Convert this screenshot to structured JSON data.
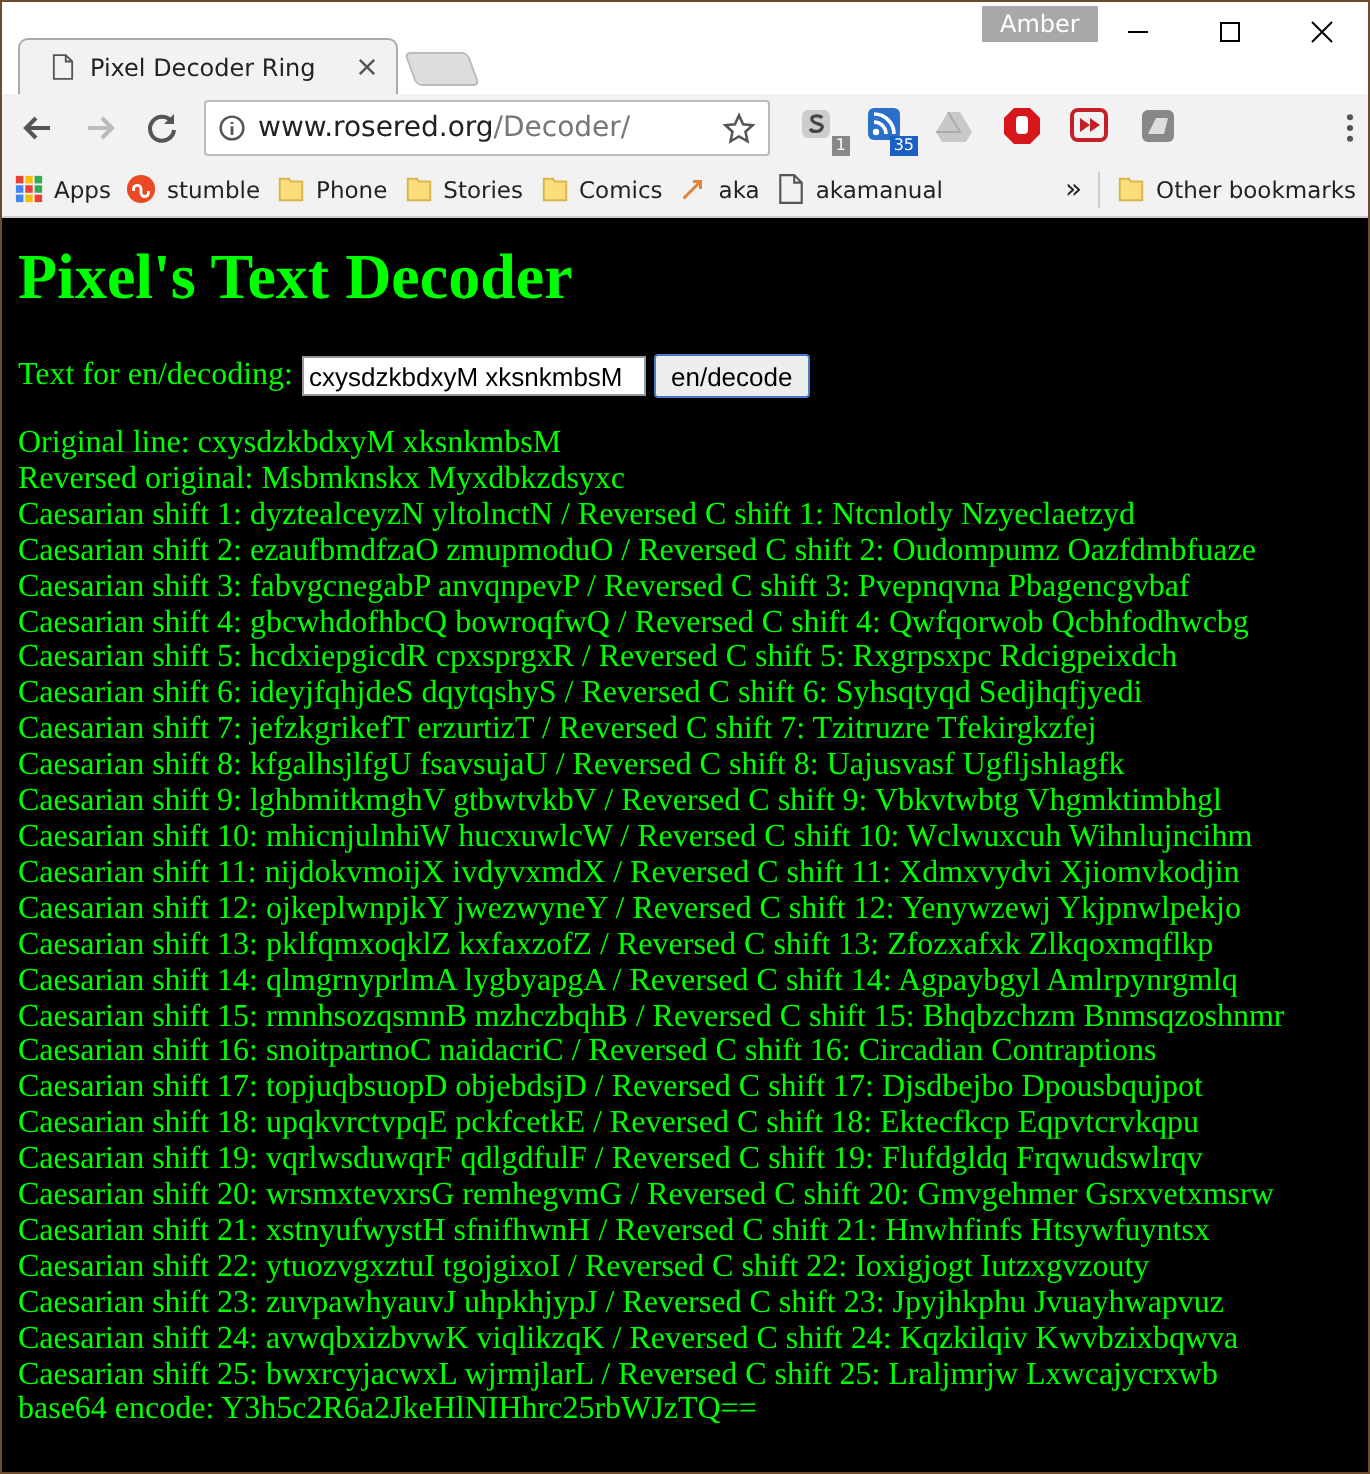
{
  "profile": "Amber",
  "tabs": [
    {
      "title": "Pixel Decoder Ring",
      "selected": true
    }
  ],
  "address": {
    "host": "www.rosered.org",
    "path": "/Decoder/"
  },
  "extensions": [
    {
      "kind": "s",
      "badge": "1"
    },
    {
      "kind": "feed",
      "badge": "35"
    },
    {
      "kind": "drive"
    },
    {
      "kind": "stop"
    },
    {
      "kind": "play"
    },
    {
      "kind": "box"
    }
  ],
  "bookmarks": [
    {
      "kind": "apps",
      "label": "Apps"
    },
    {
      "kind": "stumble",
      "label": "stumble"
    },
    {
      "kind": "folder",
      "label": "Phone"
    },
    {
      "kind": "folder",
      "label": "Stories"
    },
    {
      "kind": "folder",
      "label": "Comics"
    },
    {
      "kind": "link",
      "label": "aka"
    },
    {
      "kind": "page",
      "label": "akamanual"
    }
  ],
  "bookmarks_overflow": "»",
  "other_bookmarks": "Other bookmarks",
  "page": {
    "heading": "Pixel's Text Decoder",
    "form": {
      "label": "Text for en/decoding:",
      "value": "cxysdzkbdxyM xksnkmbsM",
      "button": "en/decode"
    },
    "output_lines": [
      "Original line: cxysdzkbdxyM xksnkmbsM",
      "Reversed original: Msbmknskx Myxdbkzdsyxc",
      "Caesarian shift 1: dyztealceyzN yltolnctN / Reversed C shift 1: Ntcnlotly Nzyeclaetzyd",
      "Caesarian shift 2: ezaufbmdfzaO zmupmoduO / Reversed C shift 2: Oudompumz Oazfdmbfuaze",
      "Caesarian shift 3: fabvgcnegabP anvqnpevP / Reversed C shift 3: Pvepnqvna Pbagencgvbaf",
      "Caesarian shift 4: gbcwhdofhbcQ bowroqfwQ / Reversed C shift 4: Qwfqorwob Qcbhfodhwcbg",
      "Caesarian shift 5: hcdxiepgicdR cpxsprgxR / Reversed C shift 5: Rxgrpsxpc Rdcigpeixdch",
      "Caesarian shift 6: ideyjfqhjdeS dqytqshyS / Reversed C shift 6: Syhsqtyqd Sedjhqfjyedi",
      "Caesarian shift 7: jefzkgrikefT erzurtizT / Reversed C shift 7: Tzitruzre Tfekirgkzfej",
      "Caesarian shift 8: kfgalhsjlfgU fsavsujaU / Reversed C shift 8: Uajusvasf Ugfljshlagfk",
      "Caesarian shift 9: lghbmitkmghV gtbwtvkbV / Reversed C shift 9: Vbkvtwbtg Vhgmktimbhgl",
      "Caesarian shift 10: mhicnjulnhiW hucxuwlcW / Reversed C shift 10: Wclwuxcuh Wihnlujncihm",
      "Caesarian shift 11: nijdokvmoijX ivdyvxmdX / Reversed C shift 11: Xdmxvydvi Xjiomvkodjin",
      "Caesarian shift 12: ojkeplwnpjkY jwezwyneY / Reversed C shift 12: Yenywzewj Ykjpnwlpekjo",
      "Caesarian shift 13: pklfqmxoqklZ kxfaxzofZ / Reversed C shift 13: Zfozxafxk Zlkqoxmqflkp",
      "Caesarian shift 14: qlmgrnyprlmA lygbyapgA / Reversed C shift 14: Agpaybgyl Amlrpynrgmlq",
      "Caesarian shift 15: rmnhsozqsmnB mzhczbqhB / Reversed C shift 15: Bhqbzchzm Bnmsqzoshnmr",
      "Caesarian shift 16: snoitpartnoC naidacriC / Reversed C shift 16: Circadian Contraptions",
      "Caesarian shift 17: topjuqbsuopD objebdsjD / Reversed C shift 17: Djsdbejbo Dpousbqujpot",
      "Caesarian shift 18: upqkvrctvpqE pckfcetkE / Reversed C shift 18: Ektecfkcp Eqpvtcrvkqpu",
      "Caesarian shift 19: vqrlwsduwqrF qdlgdfulF / Reversed C shift 19: Flufdgldq Frqwudswlrqv",
      "Caesarian shift 20: wrsmxtevxrsG remhegvmG / Reversed C shift 20: Gmvgehmer Gsrxvetxmsrw",
      "Caesarian shift 21: xstnyufwystH sfnifhwnH / Reversed C shift 21: Hnwhfinfs Htsywfuyntsx",
      "Caesarian shift 22: ytuozvgxztuI tgojgixoI / Reversed C shift 22: Ioxigjogt Iutzxgvzouty",
      "Caesarian shift 23: zuvpawhyauvJ uhpkhjypJ / Reversed C shift 23: Jpyjhkphu Jvuayhwapvuz",
      "Caesarian shift 24: avwqbxizbvwK viqlikzqK / Reversed C shift 24: Kqzkilqiv Kwvbzixbqwva",
      "Caesarian shift 25: bwxrcyjacwxL wjrmjlarL / Reversed C shift 25: Lraljmrjw Lxwcajycrxwb",
      "base64 encode: Y3h5c2R6a2JkeHlNIHhrc25rbWJzTQ=="
    ]
  }
}
